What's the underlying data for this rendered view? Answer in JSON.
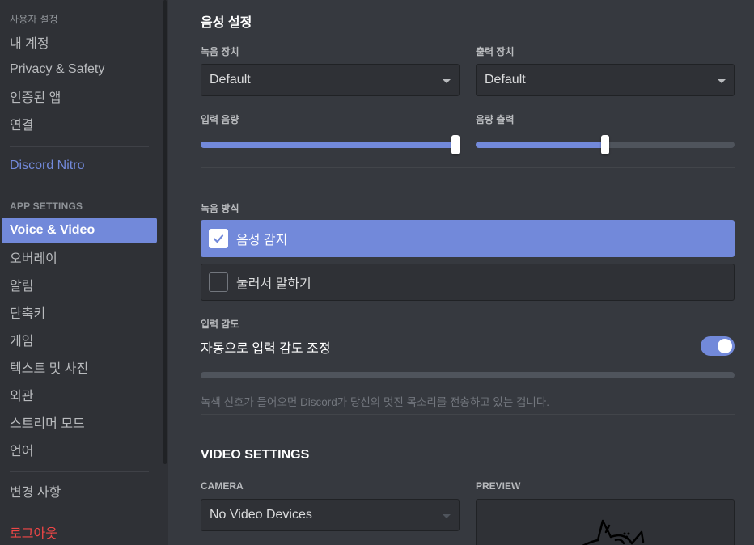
{
  "sidebar": {
    "user_settings_header": "사용자 설정",
    "user_items": [
      "내 계정",
      "Privacy & Safety",
      "인증된 앱",
      "연결"
    ],
    "nitro": "Discord Nitro",
    "app_settings_header": "APP SETTINGS",
    "app_items": [
      "Voice & Video",
      "오버레이",
      "알림",
      "단축키",
      "게임",
      "텍스트 및 사진",
      "외관",
      "스트리머 모드",
      "언어"
    ],
    "active_item": "Voice & Video",
    "changelog": "변경 사항",
    "logout": "로그아웃"
  },
  "voice": {
    "title": "음성 설정",
    "input_device_label": "녹음 장치",
    "input_device_value": "Default",
    "output_device_label": "출력 장치",
    "output_device_value": "Default",
    "input_volume_label": "입력 음량",
    "input_volume_percent": 100,
    "output_volume_label": "음량 출력",
    "output_volume_percent": 50,
    "input_mode_label": "녹음 방식",
    "mode_voice_activity": "음성 감지",
    "mode_push_to_talk": "눌러서 말하기",
    "selected_mode": "음성 감지",
    "sensitivity_label": "입력 감도",
    "auto_sensitivity_label": "자동으로 입력 감도 조정",
    "auto_sensitivity_enabled": true,
    "sensitivity_note": "녹색 신호가 들어오면 Discord가 당신의 멋진 목소리를 전송하고 있는 겁니다."
  },
  "video": {
    "title": "VIDEO SETTINGS",
    "camera_label": "CAMERA",
    "camera_value": "No Video Devices",
    "preview_label": "PREVIEW"
  },
  "colors": {
    "accent": "#7289da",
    "danger": "#f04747",
    "background": "#36393f",
    "sidebar": "#2f3136"
  }
}
